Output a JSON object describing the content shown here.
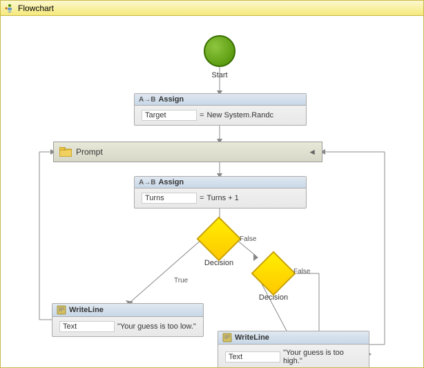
{
  "window": {
    "title": "Flowchart",
    "title_icon": "flowchart-icon"
  },
  "flowchart": {
    "start_label": "Start",
    "assign1": {
      "header": "Assign",
      "target_label": "Target",
      "operator": "=",
      "value": "New System.Randc"
    },
    "prompt": {
      "label": "Prompt"
    },
    "assign2": {
      "header": "Assign",
      "target_label": "Turns",
      "operator": "=",
      "value": "Turns + 1"
    },
    "decision1": {
      "label": "Decision"
    },
    "decision2": {
      "label": "Decision"
    },
    "false_label1": "False",
    "false_label2": "False",
    "true_label": "True",
    "writeline1": {
      "header": "WriteLine",
      "field_label": "Text",
      "value": "\"Your guess is too low.\""
    },
    "writeline2": {
      "header": "WriteLine",
      "field_label": "Text",
      "value": "\"Your guess is too high.\""
    }
  }
}
